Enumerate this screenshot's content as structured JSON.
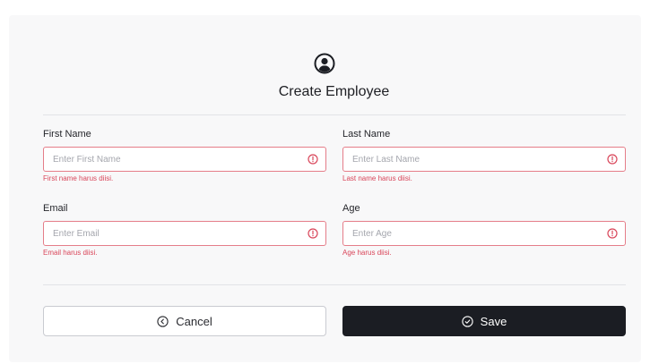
{
  "form": {
    "title": "Create Employee",
    "icon": "user-circle-icon",
    "fields": {
      "first_name": {
        "label": "First Name",
        "placeholder": "Enter First Name",
        "value": "",
        "error": "First name harus diisi."
      },
      "last_name": {
        "label": "Last Name",
        "placeholder": "Enter Last Name",
        "value": "",
        "error": "Last name harus diisi."
      },
      "email": {
        "label": "Email",
        "placeholder": "Enter Email",
        "value": "",
        "error": "Email harus diisi."
      },
      "age": {
        "label": "Age",
        "placeholder": "Enter Age",
        "value": "",
        "error": "Age harus diisi."
      }
    },
    "buttons": {
      "cancel": {
        "label": "Cancel",
        "icon": "circle-arrow-left-icon"
      },
      "save": {
        "label": "Save",
        "icon": "circle-check-icon"
      }
    },
    "colors": {
      "error": "#d9465a",
      "error_border": "#e57d89",
      "primary": "#1b1d23",
      "background": "#f8f8f9"
    }
  }
}
